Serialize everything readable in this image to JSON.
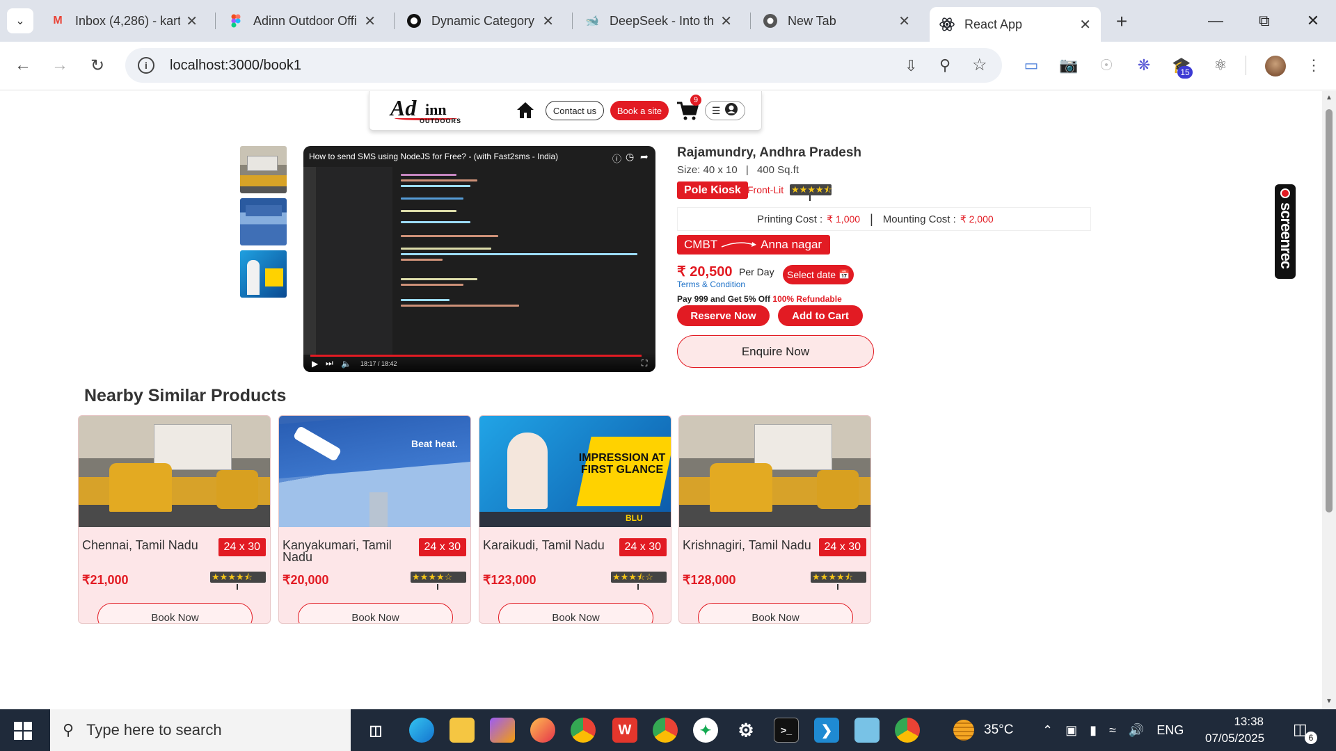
{
  "browser": {
    "tabs": [
      {
        "title": "Inbox (4,286) - kart",
        "icon": "gmail-icon"
      },
      {
        "title": "Adinn Outdoor Offi",
        "icon": "figma-icon"
      },
      {
        "title": "Dynamic Category",
        "icon": "github-icon"
      },
      {
        "title": "DeepSeek - Into th",
        "icon": "deepseek-icon"
      },
      {
        "title": "New Tab",
        "icon": "chrome-icon"
      },
      {
        "title": "React App",
        "icon": "react-icon"
      }
    ],
    "url": "localhost:3000/book1",
    "extension_badge": "15"
  },
  "header": {
    "logo_main": "Ad",
    "logo_inn": "inn",
    "logo_sub": "OUTDOORS",
    "contact_label": "Contact us",
    "book_label": "Book a site",
    "cart_count": "9"
  },
  "video": {
    "title": "How to send SMS using NodeJS for Free? - (with Fast2sms - India)",
    "time": "18:17 / 18:42",
    "progress": 0.98
  },
  "product": {
    "location": "Rajamundry, Andhra Pradesh",
    "size_text": "Size: 40 x 10",
    "sep": "|",
    "area_text": "400 Sq.ft",
    "type": "Pole Kiosk",
    "lighting": "Front-Lit",
    "rating": 4.5,
    "printing_label": "Printing Cost :",
    "printing_value": "₹ 1,000",
    "mounting_label": "Mounting Cost :",
    "mounting_value": "₹ 2,000",
    "route_from": "CMBT",
    "route_to": "Anna nagar",
    "price": "₹ 20,500",
    "per_day": "Per Day",
    "select_date": "Select date",
    "terms": "Terms & Condition",
    "offer": "Pay 999 and Get 5% Off",
    "refundable": "100% Refundable",
    "reserve": "Reserve Now",
    "add_cart": "Add to Cart",
    "enquire": "Enquire Now"
  },
  "screenrec": "screenrec",
  "nearby": {
    "title": "Nearby Similar Products",
    "items": [
      {
        "name": "Chennai, Tamil Nadu",
        "size": "24 x 30",
        "price": "₹21,000",
        "rating": 4.5,
        "book": "Book Now"
      },
      {
        "name": "Kanyakumari, Tamil Nadu",
        "size": "24 x 30",
        "price": "₹20,000",
        "rating": 4.0,
        "book": "Book Now"
      },
      {
        "name": "Karaikudi, Tamil Nadu",
        "size": "24 x 30",
        "price": "₹123,000",
        "rating": 3.5,
        "book": "Book Now"
      },
      {
        "name": "Krishnagiri, Tamil Nadu",
        "size": "24 x 30",
        "price": "₹128,000",
        "rating": 4.5,
        "book": "Book Now"
      }
    ],
    "billboard_texts": {
      "heat": "Beat heat.",
      "impression": "IMPRESSION AT FIRST GLANCE",
      "blu": "BLU"
    }
  },
  "taskbar": {
    "search_placeholder": "Type here to search",
    "temperature": "35°C",
    "language": "ENG",
    "time": "13:38",
    "date": "07/05/2025",
    "notifications": "6"
  },
  "colors": {
    "brand_red": "#e21b23",
    "card_pink": "#fde6e8"
  }
}
